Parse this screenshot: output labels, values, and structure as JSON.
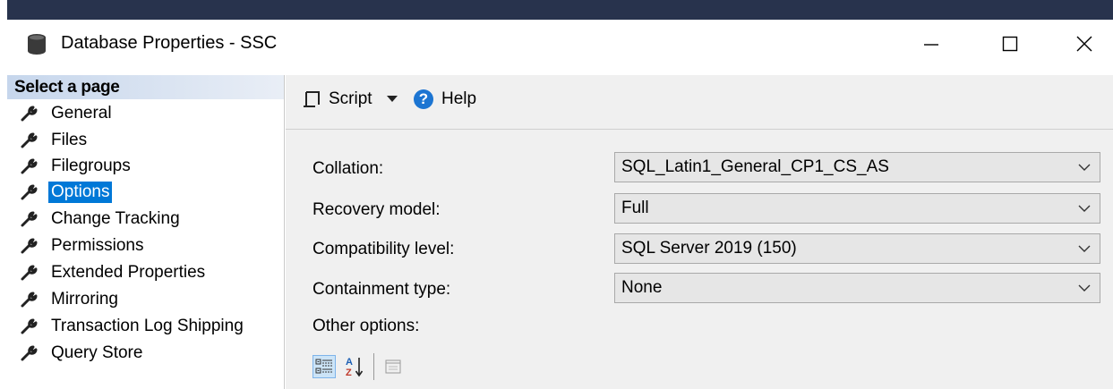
{
  "window": {
    "title": "Database Properties - SSC",
    "icons": {
      "app": "database-icon",
      "minimize": "minimize-icon",
      "maximize": "maximize-icon",
      "close": "close-icon"
    }
  },
  "sidebar": {
    "header": "Select a page",
    "items": [
      {
        "label": "General",
        "icon": "wrench-icon"
      },
      {
        "label": "Files",
        "icon": "wrench-icon"
      },
      {
        "label": "Filegroups",
        "icon": "wrench-icon"
      },
      {
        "label": "Options",
        "icon": "wrench-icon",
        "selected": true
      },
      {
        "label": "Change Tracking",
        "icon": "wrench-icon"
      },
      {
        "label": "Permissions",
        "icon": "wrench-icon"
      },
      {
        "label": "Extended Properties",
        "icon": "wrench-icon"
      },
      {
        "label": "Mirroring",
        "icon": "wrench-icon"
      },
      {
        "label": "Transaction Log Shipping",
        "icon": "wrench-icon"
      },
      {
        "label": "Query Store",
        "icon": "wrench-icon"
      }
    ]
  },
  "toolbar": {
    "script_label": "Script",
    "help_label": "Help",
    "help_glyph": "?"
  },
  "form": {
    "collation_label": "Collation:",
    "collation_value": "SQL_Latin1_General_CP1_CS_AS",
    "recovery_label": "Recovery model:",
    "recovery_value": "Full",
    "compat_label": "Compatibility level:",
    "compat_value": "SQL Server 2019 (150)",
    "containment_label": "Containment type:",
    "containment_value": "None",
    "other_options_label": "Other options:"
  },
  "colors": {
    "accent": "#0078d7",
    "title_bar_strip": "#28334d",
    "help_icon": "#1c75d2"
  }
}
